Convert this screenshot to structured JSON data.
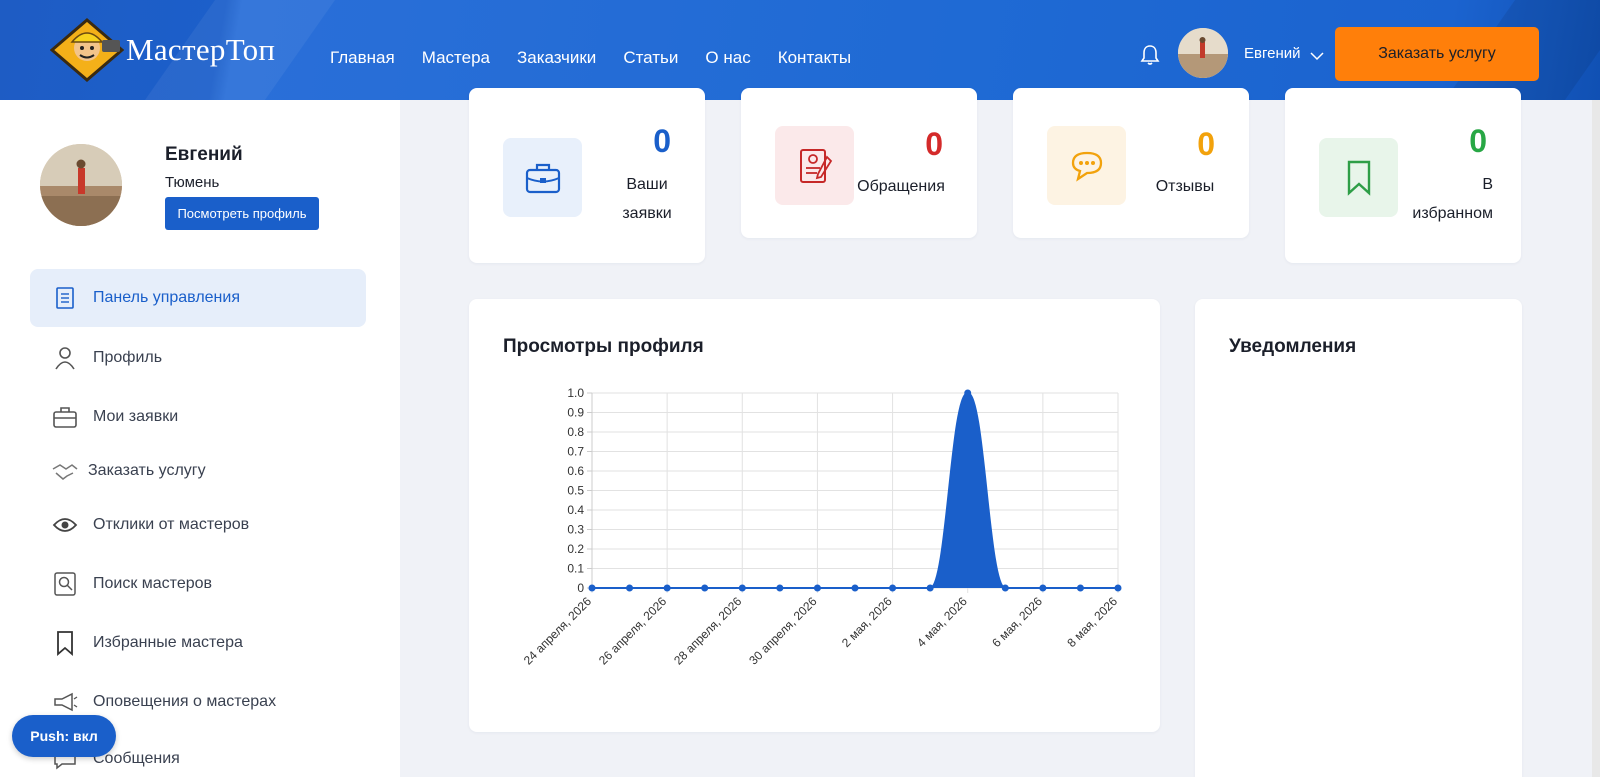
{
  "header": {
    "logo_text": "МастерТоп",
    "nav": [
      "Главная",
      "Мастера",
      "Заказчики",
      "Статьи",
      "О нас",
      "Контакты"
    ],
    "user_name": "Евгений",
    "order_button": "Заказать услугу",
    "bell_icon": "bell-icon",
    "chevron_icon": "chevron-down-icon"
  },
  "sidebar": {
    "profile": {
      "name": "Евгений",
      "city": "Тюмень",
      "view_button": "Посмотреть профиль"
    },
    "items": [
      {
        "label": "Панель управления",
        "icon": "dashboard-icon",
        "active": true
      },
      {
        "label": "Профиль",
        "icon": "user-icon"
      },
      {
        "label": "Мои заявки",
        "icon": "briefcase-icon"
      },
      {
        "label": "Заказать услугу",
        "icon": "handshake-icon"
      },
      {
        "label": "Отклики от мастеров",
        "icon": "eye-icon"
      },
      {
        "label": "Поиск мастеров",
        "icon": "search-user-icon"
      },
      {
        "label": "Избранные мастера",
        "icon": "bookmark-icon"
      },
      {
        "label": "Оповещения о мастерах",
        "icon": "megaphone-icon"
      },
      {
        "label": "Сообщения",
        "icon": "chat-icon"
      }
    ],
    "push_button": "Push: вкл"
  },
  "stats": [
    {
      "value": "0",
      "label_lines": [
        "Ваши",
        "заявки"
      ],
      "color": "#1a5fca",
      "icon": "briefcase-icon"
    },
    {
      "value": "0",
      "label_lines": [
        "Обращения"
      ],
      "color": "#d42a2a",
      "icon": "document-icon"
    },
    {
      "value": "0",
      "label_lines": [
        "Отзывы"
      ],
      "color": "#f2a20c",
      "icon": "chat-bubble-icon"
    },
    {
      "value": "0",
      "label_lines": [
        "В",
        "избранном"
      ],
      "color": "#28a745",
      "icon": "bookmark-icon"
    }
  ],
  "views_panel": {
    "title": "Просмотры профиля"
  },
  "notifications_panel": {
    "title": "Уведомления"
  },
  "chart_data": {
    "type": "area",
    "x": [
      "24 апреля, 2026",
      "25 апреля, 2026",
      "26 апреля, 2026",
      "27 апреля, 2026",
      "28 апреля, 2026",
      "29 апреля, 2026",
      "30 апреля, 2026",
      "1 мая, 2026",
      "2 мая, 2026",
      "3 мая, 2026",
      "4 мая, 2026",
      "5 мая, 2026",
      "6 мая, 2026",
      "7 мая, 2026",
      "8 мая, 2026"
    ],
    "x_tick_labels": [
      "24 апреля, 2026",
      "26 апреля, 2026",
      "28 апреля, 2026",
      "30 апреля, 2026",
      "2 мая, 2026",
      "4 мая, 2026",
      "6 мая, 2026",
      "8 мая, 2026"
    ],
    "values": [
      0,
      0,
      0,
      0,
      0,
      0,
      0,
      0,
      0,
      0,
      1,
      0,
      0,
      0,
      0
    ],
    "ylim": [
      0,
      1
    ],
    "y_ticks": [
      "0",
      "0.1",
      "0.2",
      "0.3",
      "0.4",
      "0.5",
      "0.6",
      "0.7",
      "0.8",
      "0.9",
      "1.0"
    ],
    "grid": true,
    "color": "#1a5fca"
  }
}
